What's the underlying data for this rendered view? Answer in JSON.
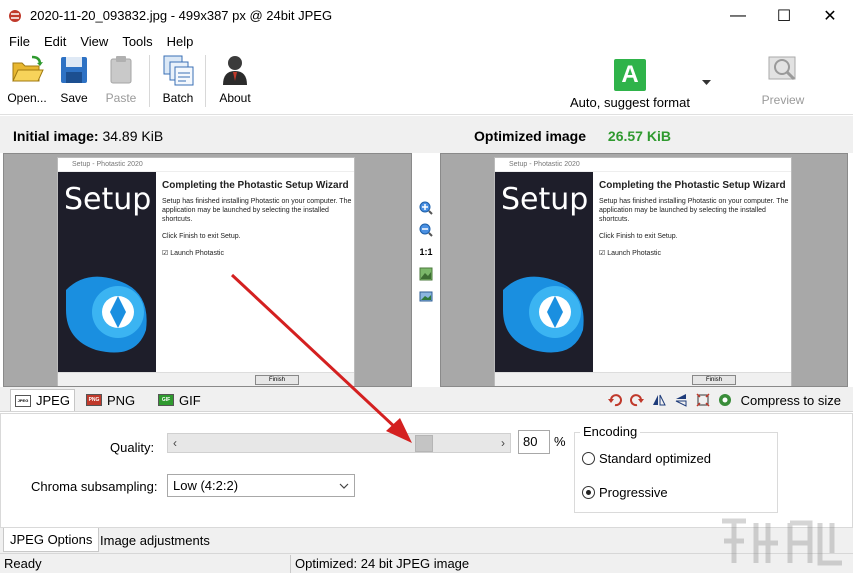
{
  "window": {
    "title": "2020-11-20_093832.jpg - 499x387 px @ 24bit JPEG",
    "minimize": "—",
    "maximize": "☐",
    "close": "✕"
  },
  "menu": [
    "File",
    "Edit",
    "View",
    "Tools",
    "Help"
  ],
  "toolbar": {
    "open": "Open...",
    "save": "Save",
    "paste": "Paste",
    "batch": "Batch",
    "about": "About",
    "auto_format": "Auto, suggest format",
    "auto_format_letter": "A",
    "preview": "Preview"
  },
  "header": {
    "initial_label": "Initial image:",
    "initial_size": "34.89 KiB",
    "optimized_label": "Optimized image",
    "optimized_size": "26.57 KiB"
  },
  "preview_image": {
    "window_title": "Setup - Photastic 2020",
    "setup_word": "Setup",
    "heading": "Completing the Photastic Setup Wizard",
    "para1": "Setup has finished installing Photastic on your computer. The application may be launched by selecting the installed shortcuts.",
    "para2": "Click Finish to exit Setup.",
    "checkbox": "Launch Photastic",
    "finish": "Finish"
  },
  "zoom_tools": {
    "one_to_one": "1:1"
  },
  "format_tabs": [
    "JPEG",
    "PNG",
    "GIF"
  ],
  "format_icons": [
    "JPEG",
    "PNG",
    "GIF"
  ],
  "compress_to_size": "Compress to size",
  "options": {
    "quality_label": "Quality:",
    "quality_value": "80",
    "quality_unit": "%",
    "quality_fraction": 0.8,
    "chroma_label": "Chroma subsampling:",
    "chroma_value": "Low (4:2:2)",
    "encoding_title": "Encoding",
    "encoding_options": [
      "Standard optimized",
      "Progressive"
    ],
    "encoding_selected": "Progressive"
  },
  "bottom_tabs": [
    "JPEG Options",
    "Image adjustments"
  ],
  "status": {
    "left": "Ready",
    "right": "Optimized: 24 bit JPEG image"
  },
  "colors": {
    "accent_green": "#2f9a2f",
    "auto_icon_green": "#2fb34a",
    "arrow_red": "#d42020"
  }
}
